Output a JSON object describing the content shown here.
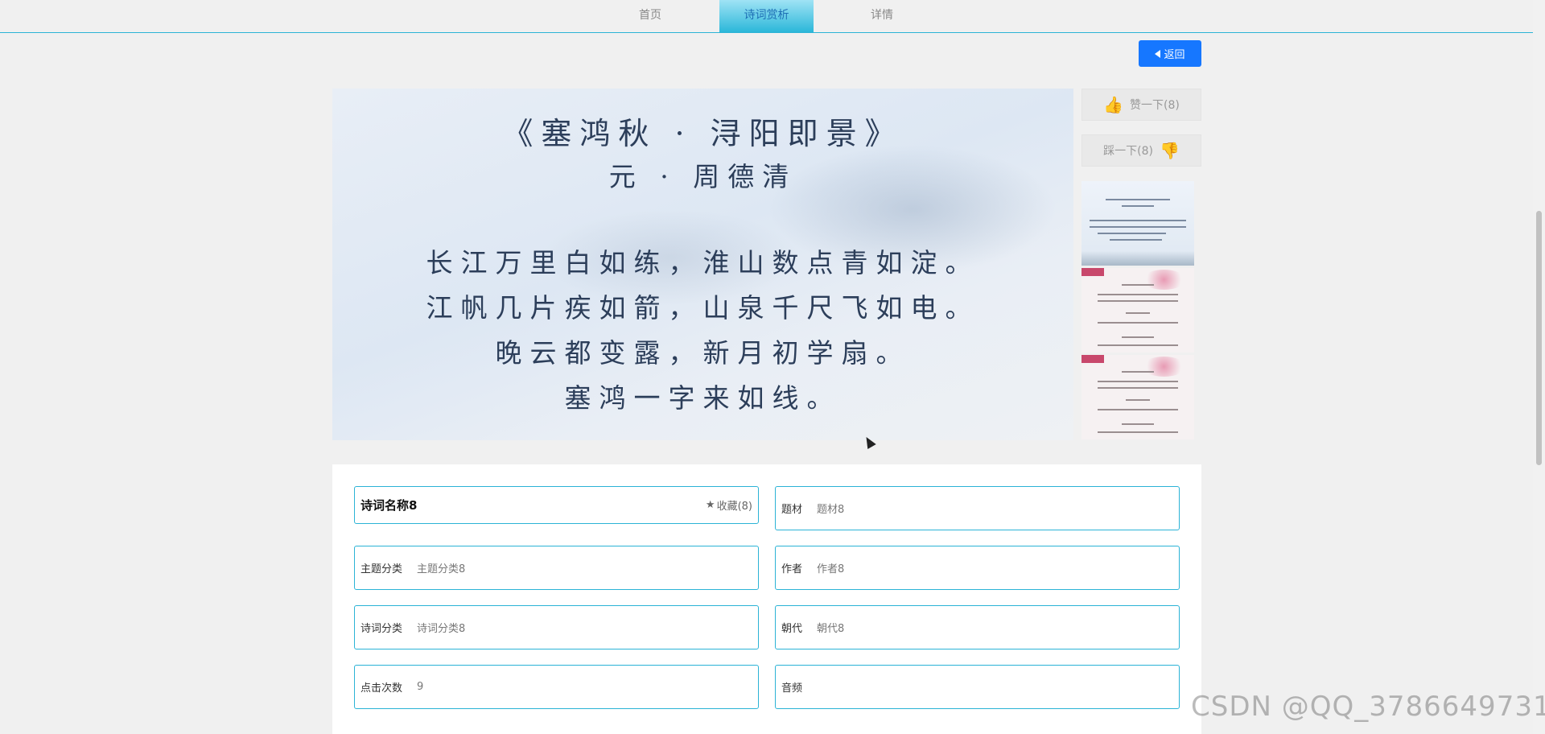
{
  "nav": {
    "items": [
      {
        "label": "首页"
      },
      {
        "label": "诗词赏析"
      },
      {
        "label": "详情"
      }
    ]
  },
  "back_button": {
    "label": "返回"
  },
  "poem_image": {
    "title": "《塞鸿秋 · 浔阳即景》",
    "author": "元 · 周德清",
    "lines": [
      "长江万里白如练，淮山数点青如淀。",
      "江帆几片疾如箭，山泉千尺飞如电。",
      "晚云都变露，新月初学扇。",
      "塞鸿一字来如线。"
    ]
  },
  "votes": {
    "like_label": "赞一下(8)",
    "dislike_label": "踩一下(8)"
  },
  "details": {
    "name": "诗词名称8",
    "favorite_label": "收藏(8)",
    "fields": {
      "ticai": {
        "label": "题材",
        "value": "题材8"
      },
      "zhuti": {
        "label": "主题分类",
        "value": "主题分类8"
      },
      "zuozhe": {
        "label": "作者",
        "value": "作者8"
      },
      "shici": {
        "label": "诗词分类",
        "value": "诗词分类8"
      },
      "chaodai": {
        "label": "朝代",
        "value": "朝代8"
      },
      "clicks": {
        "label": "点击次数",
        "value": "9"
      },
      "audio": {
        "label": "音频",
        "value": ""
      }
    }
  },
  "watermark": "CSDN @QQ_3786649731",
  "icons": {
    "thumbs_up": "thumbs-up-icon",
    "thumbs_down": "thumbs-down-icon",
    "star": "star-icon",
    "back": "back-arrow-icon"
  },
  "colors": {
    "accent": "#2bb3d6",
    "primary_button": "#1677ff",
    "active_tab_text": "#1e6fb5"
  }
}
